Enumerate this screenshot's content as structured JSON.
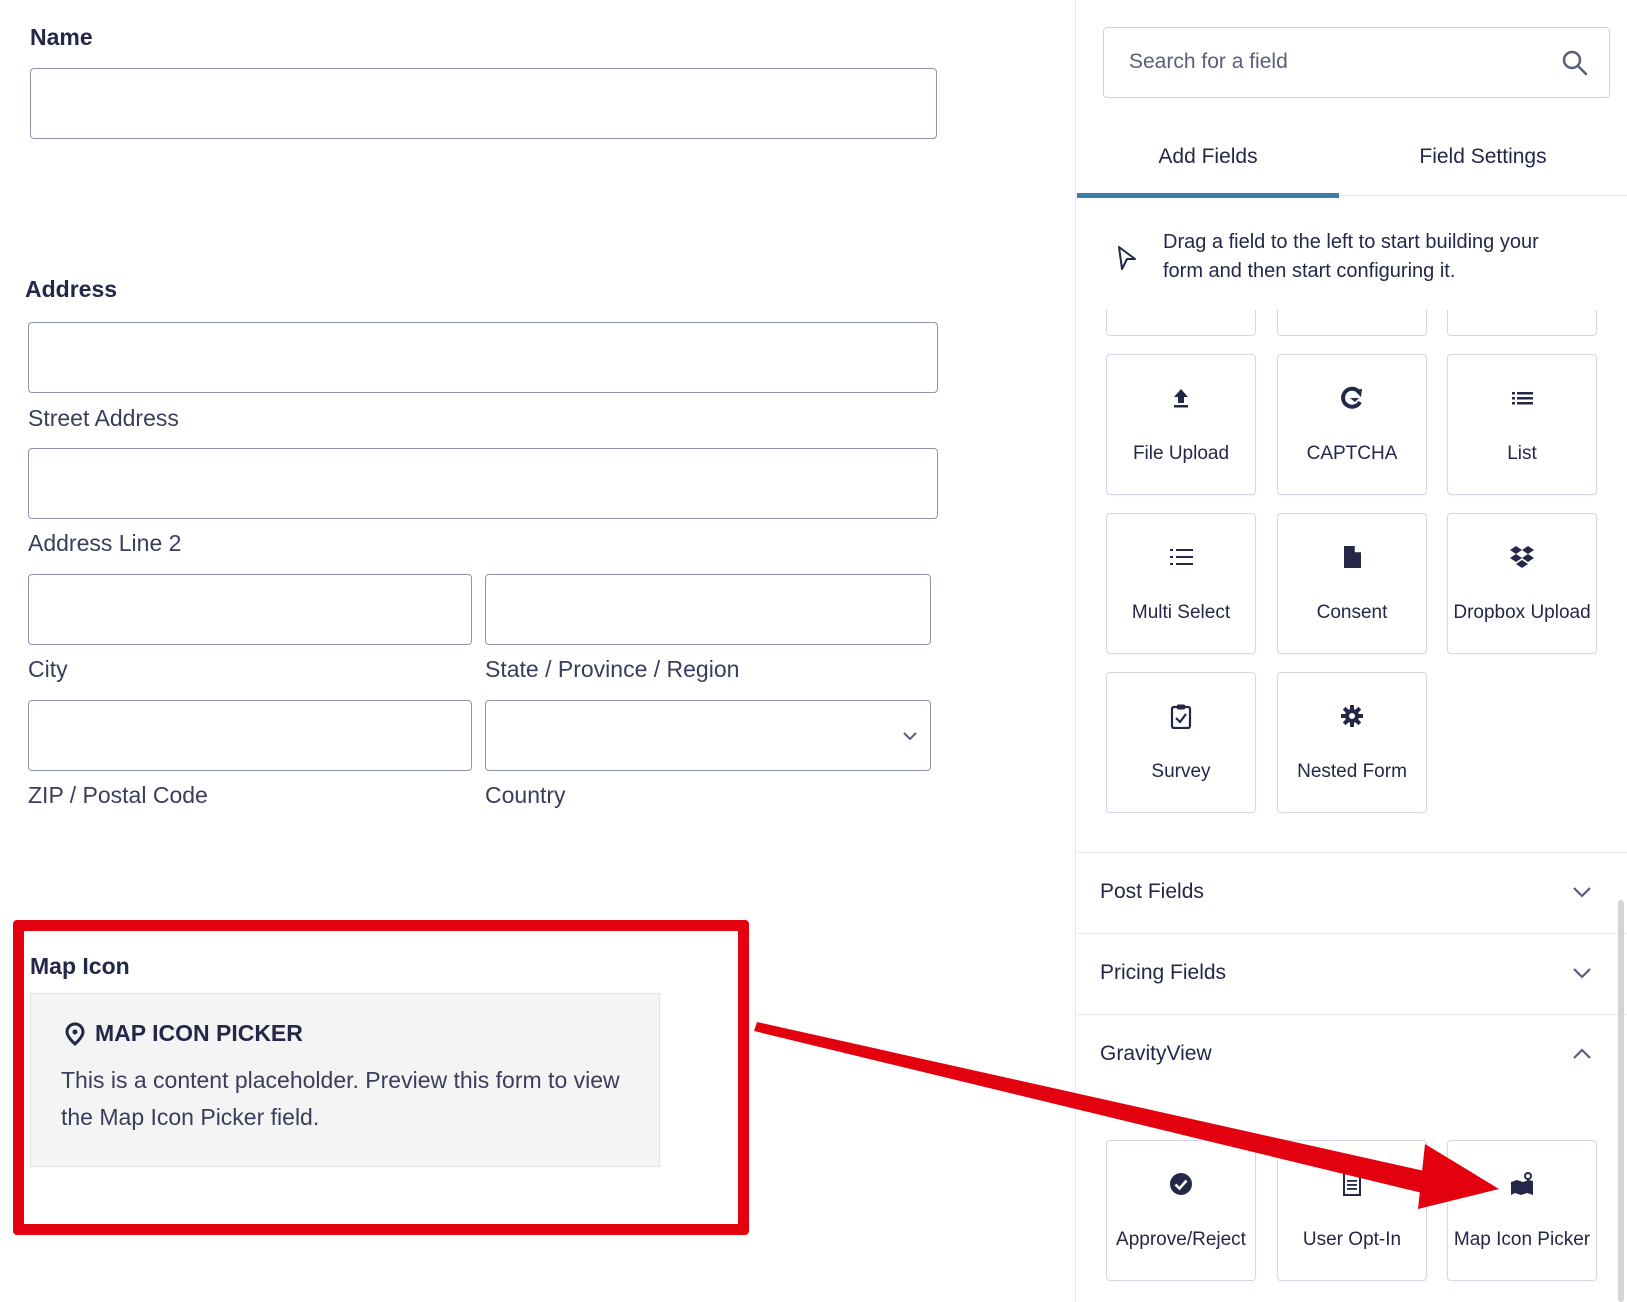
{
  "form": {
    "name": {
      "label": "Name"
    },
    "address": {
      "label": "Address",
      "street": "Street Address",
      "line2": "Address Line 2",
      "city": "City",
      "state": "State / Province / Region",
      "zip": "ZIP / Postal Code",
      "country": "Country"
    },
    "map_icon": {
      "label": "Map Icon",
      "placeholder_title": "MAP ICON PICKER",
      "placeholder_text": "This is a content placeholder. Preview this form to view the Map Icon Picker field."
    }
  },
  "sidebar": {
    "search": {
      "placeholder": "Search for a field"
    },
    "tabs": [
      {
        "label": "Add Fields",
        "active": true
      },
      {
        "label": "Field Settings",
        "active": false
      }
    ],
    "hint": "Drag a field to the left to start building your form and then start configuring it.",
    "advanced_fields": [
      {
        "label": "File Upload",
        "icon": "upload-icon"
      },
      {
        "label": "CAPTCHA",
        "icon": "captcha-icon"
      },
      {
        "label": "List",
        "icon": "list-icon"
      },
      {
        "label": "Multi Select",
        "icon": "multi-select-icon"
      },
      {
        "label": "Consent",
        "icon": "document-icon"
      },
      {
        "label": "Dropbox Upload",
        "icon": "dropbox-icon"
      },
      {
        "label": "Survey",
        "icon": "clipboard-check-icon"
      },
      {
        "label": "Nested Form",
        "icon": "gear-icon"
      }
    ],
    "sections": [
      {
        "title": "Post Fields",
        "expanded": false
      },
      {
        "title": "Pricing Fields",
        "expanded": false
      },
      {
        "title": "GravityView",
        "expanded": true
      }
    ],
    "gravityview_fields": [
      {
        "label": "Approve/Reject",
        "icon": "check-circle-icon"
      },
      {
        "label": "User Opt-In",
        "icon": "document-lines-icon"
      },
      {
        "label": "Map Icon Picker",
        "icon": "map-pin-icon"
      }
    ]
  },
  "colors": {
    "accent": "#3e7da6",
    "highlight": "#e3000f",
    "text": "#242748",
    "border": "#9092b2"
  }
}
